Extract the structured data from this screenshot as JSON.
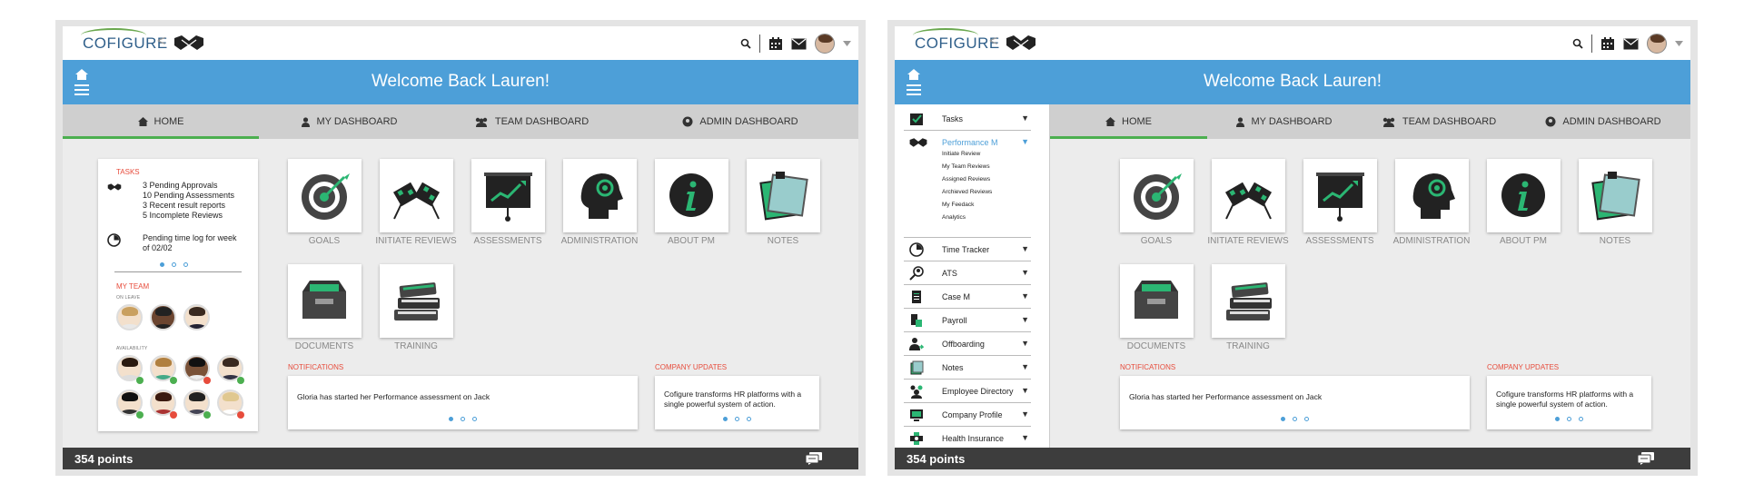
{
  "topbar": {
    "logo": "COFIGURE",
    "chevron": "<"
  },
  "banner": {
    "title": "Welcome Back Lauren!"
  },
  "nav": [
    {
      "label": "HOME",
      "icon": "home-icon"
    },
    {
      "label": "MY DASHBOARD",
      "icon": "user-icon"
    },
    {
      "label": "TEAM DASHBOARD",
      "icon": "group-icon"
    },
    {
      "label": "ADMIN DASHBOARD",
      "icon": "admin-icon"
    }
  ],
  "tasks": {
    "label": "TASKS",
    "line1": "3 Pending Approvals",
    "line2": "10 Pending Assessments",
    "line3": "3 Recent result reports",
    "line4": "5 Incomplete Reviews",
    "time1": "Pending time log for week",
    "time2": "of 02/02"
  },
  "team": {
    "label": "MY TEAM",
    "on_leave": "ON LEAVE",
    "availability": "AVAILABILITY"
  },
  "tiles": [
    "GOALS",
    "INITIATE REVIEWS",
    "ASSESSMENTS",
    "ADMINISTRATION",
    "ABOUT PM",
    "NOTES",
    "DOCUMENTS",
    "TRAINING"
  ],
  "notifications": {
    "label": "NOTIFICATIONS",
    "text": "Gloria has started her Performance assessment on Jack"
  },
  "company": {
    "label": "COMPANY UPDATES",
    "text1": "Cofigure transforms HR platforms with a",
    "text2": "single powerful system of action."
  },
  "footer": {
    "points": "354 points"
  },
  "sidebar": {
    "items": [
      "Tasks",
      "Performance M",
      "Time Tracker",
      "ATS",
      "Case M",
      "Payroll",
      "Offboarding",
      "Notes",
      "Employee Directory",
      "Company Profile",
      "Health Insurance"
    ],
    "sub": [
      "Initiate Review",
      "My Team Reviews",
      "Assigned Reviews",
      "Archieved Reviews",
      "My Feedack",
      "Analytics"
    ]
  },
  "colors": {
    "banner": "#4d9fd8",
    "accent_green": "#4caf50",
    "section_red": "#e74c3c",
    "footer": "#3d3d3d"
  }
}
